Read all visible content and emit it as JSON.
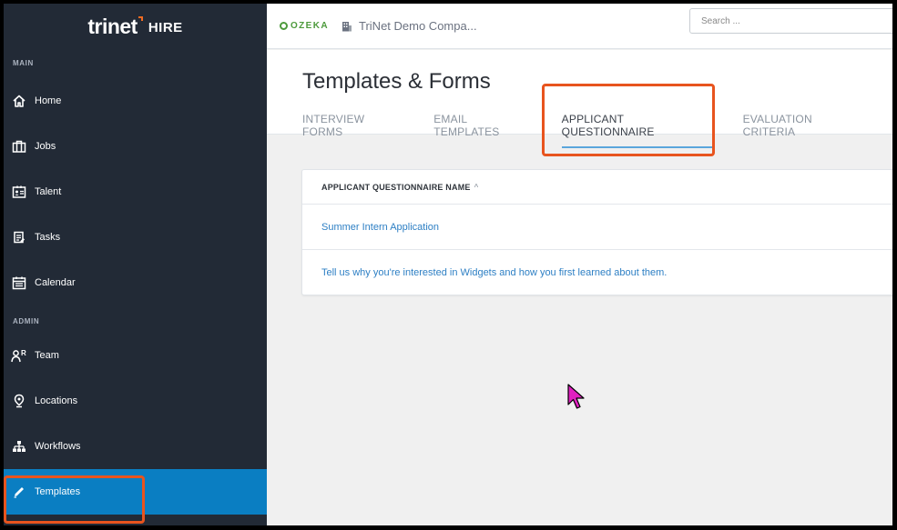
{
  "brand": {
    "logo_text": "trinet",
    "product": "HIRE"
  },
  "sidebar": {
    "main_label": "MAIN",
    "admin_label": "ADMIN",
    "main_items": [
      {
        "label": "Home",
        "icon": "home-icon"
      },
      {
        "label": "Jobs",
        "icon": "briefcase-icon"
      },
      {
        "label": "Talent",
        "icon": "id-card-icon"
      },
      {
        "label": "Tasks",
        "icon": "clipboard-icon"
      },
      {
        "label": "Calendar",
        "icon": "calendar-icon"
      }
    ],
    "admin_items": [
      {
        "label": "Team",
        "icon": "team-icon"
      },
      {
        "label": "Locations",
        "icon": "location-pin-icon"
      },
      {
        "label": "Workflows",
        "icon": "workflow-icon"
      },
      {
        "label": "Templates",
        "icon": "pencil-icon",
        "active": true
      }
    ]
  },
  "topbar": {
    "org_logo": "OZEKA",
    "company_name": "TriNet Demo Compa...",
    "search_placeholder": "Search ..."
  },
  "page": {
    "title": "Templates & Forms",
    "tabs": [
      {
        "label": "INTERVIEW FORMS"
      },
      {
        "label": "EMAIL TEMPLATES"
      },
      {
        "label": "APPLICANT QUESTIONNAIRE",
        "active": true
      },
      {
        "label": "EVALUATION CRITERIA"
      }
    ]
  },
  "table": {
    "column_header": "APPLICANT QUESTIONNAIRE NAME",
    "sort_indicator": "^",
    "rows": [
      "Summer Intern Application",
      "Tell us why you're interested in Widgets and how you first learned about them."
    ]
  },
  "colors": {
    "sidebar_bg": "#222a36",
    "active_item": "#0a7ec2",
    "highlight": "#e8541e",
    "link": "#2d7fc4",
    "cursor": "#e020c0"
  }
}
